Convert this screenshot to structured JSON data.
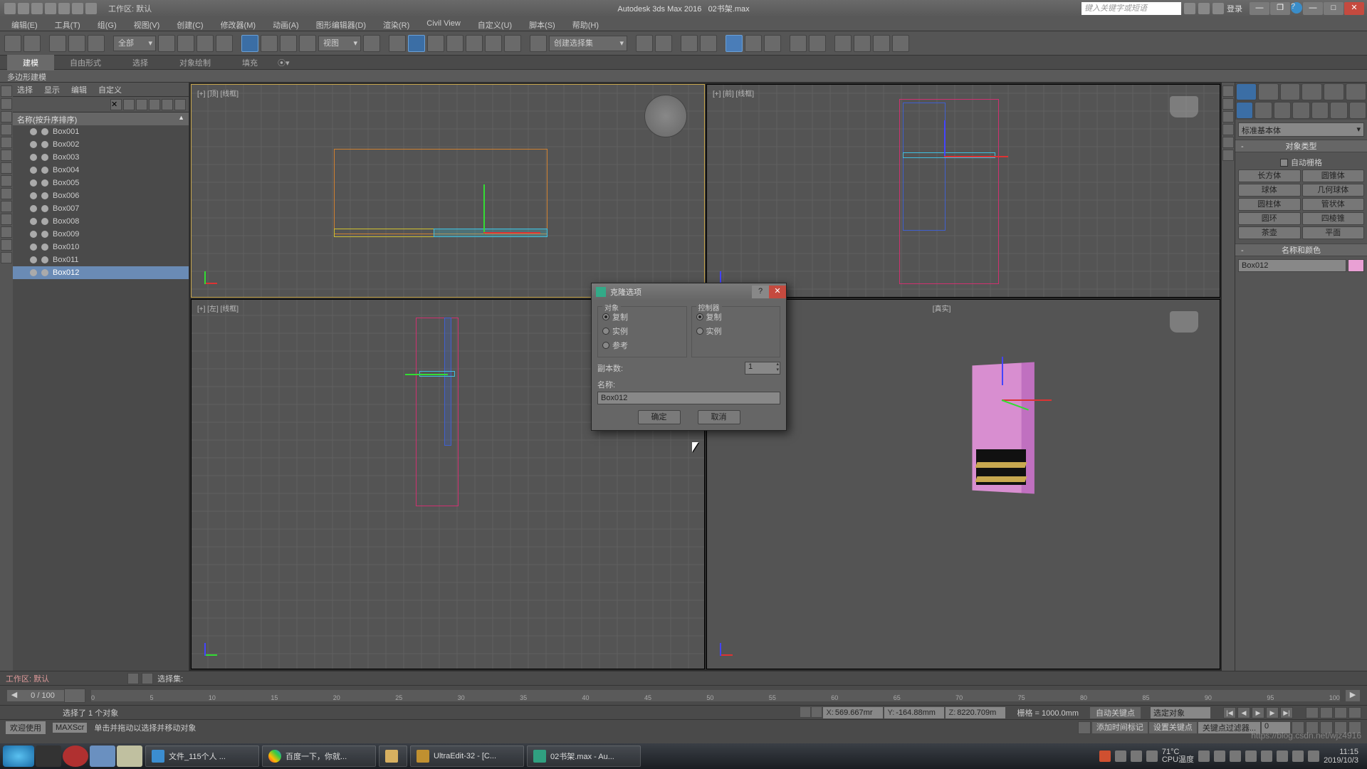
{
  "titlebar": {
    "workspace": "工作区: 默认",
    "app": "Autodesk 3ds Max 2016",
    "file": "02书架.max",
    "search_placeholder": "键入关键字或短语",
    "login": "登录"
  },
  "menu": [
    "编辑(E)",
    "工具(T)",
    "组(G)",
    "视图(V)",
    "创建(C)",
    "修改器(M)",
    "动画(A)",
    "图形编辑器(D)",
    "渲染(R)",
    "Civil View",
    "自定义(U)",
    "脚本(S)",
    "帮助(H)"
  ],
  "toolbar": {
    "all": "全部",
    "view": "视图",
    "selset": "创建选择集"
  },
  "ribbon": {
    "tabs": [
      "建模",
      "自由形式",
      "选择",
      "对象绘制",
      "填充"
    ],
    "sub": "多边形建模"
  },
  "scene": {
    "header": "名称(按升序排序)",
    "items": [
      "Box001",
      "Box002",
      "Box003",
      "Box004",
      "Box005",
      "Box006",
      "Box007",
      "Box008",
      "Box009",
      "Box010",
      "Box011",
      "Box012"
    ],
    "selected": "Box012",
    "sub_tabs": [
      "选择",
      "显示",
      "编辑",
      "自定义"
    ]
  },
  "viewports": {
    "top": "[+] [顶] [线框]",
    "front": "[+] [前] [线框]",
    "left": "[+] [左] [线框]",
    "persp": "[真实]"
  },
  "cmd": {
    "category": "标准基本体",
    "rollout_type": "对象类型",
    "autogrid": "自动栅格",
    "buttons": [
      [
        "长方体",
        "圆锥体"
      ],
      [
        "球体",
        "几何球体"
      ],
      [
        "圆柱体",
        "管状体"
      ],
      [
        "圆环",
        "四棱锥"
      ],
      [
        "茶壶",
        "平面"
      ]
    ],
    "rollout_name": "名称和颜色",
    "name_value": "Box012"
  },
  "dialog": {
    "title": "克隆选项",
    "grp1": "对象",
    "grp2": "控制器",
    "opts1": [
      "复制",
      "实例",
      "参考"
    ],
    "opts2": [
      "复制",
      "实例"
    ],
    "copies_lbl": "副本数:",
    "copies_val": "1",
    "name_lbl": "名称:",
    "name_val": "Box012",
    "ok": "确定",
    "cancel": "取消"
  },
  "bottom": {
    "ws_label": "工作区: 默认",
    "selset_label": "选择集:",
    "frame": "0 / 100",
    "ticks": [
      "0",
      "5",
      "10",
      "15",
      "20",
      "25",
      "30",
      "35",
      "40",
      "45",
      "50",
      "55",
      "60",
      "65",
      "70",
      "75",
      "80",
      "85",
      "90",
      "95",
      "100"
    ],
    "sel_info": "选择了 1 个对象",
    "hint": "单击并拖动以选择并移动对象",
    "coord_x": "569.667mr",
    "coord_y": "-164.88mm",
    "coord_z": "8220.709m",
    "grid": "栅格 = 1000.0mm",
    "autokey": "自动关键点",
    "setkey": "设置关键点",
    "selobj": "选定对象",
    "keyfilter": "关键点过滤器...",
    "addtime": "添加时间标记",
    "welcome": "欢迎使用",
    "maxscr": "MAXScr"
  },
  "taskbar": {
    "items": [
      "文件_115个人 ...",
      "百度一下，你就...",
      "",
      "UltraEdit-32 - [C...",
      "02书架.max - Au..."
    ],
    "temp": "71°C",
    "temp_lbl": "CPU温度",
    "time": "11:15",
    "date": "2019/10/3"
  },
  "watermark": "https://blog.csdn.net/wjz4916"
}
